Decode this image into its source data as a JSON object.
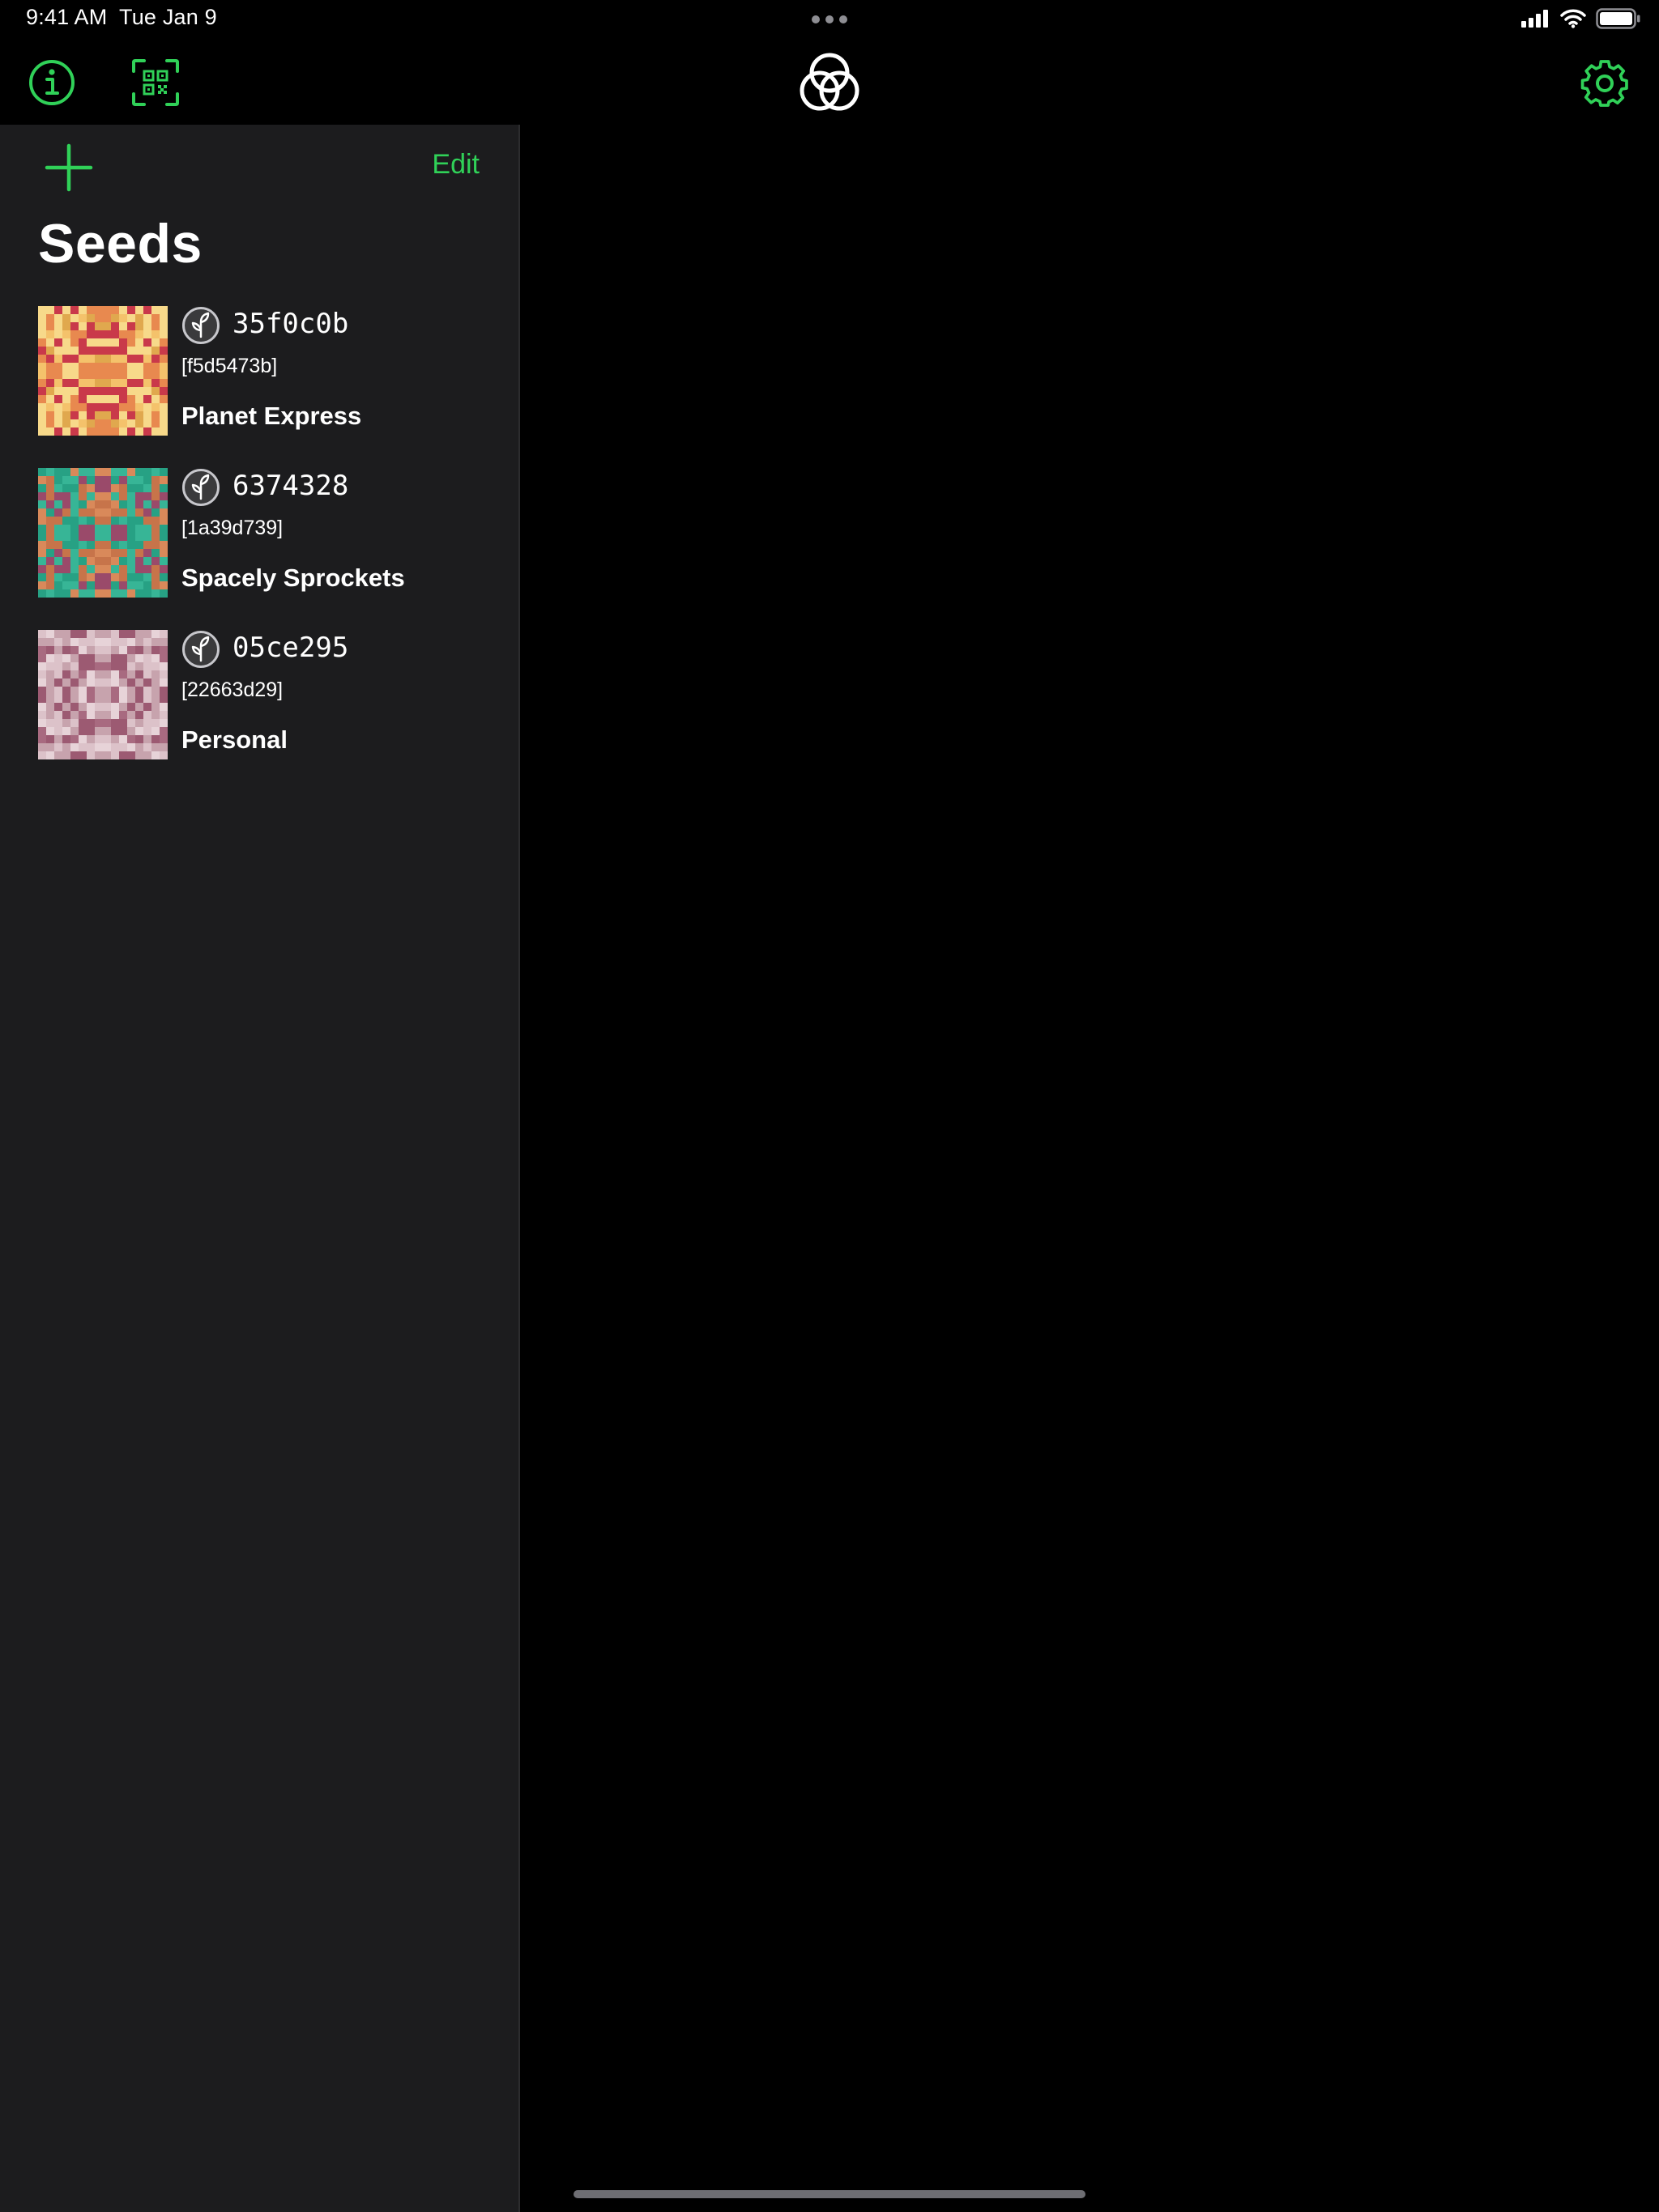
{
  "status_bar": {
    "time": "9:41 AM",
    "date": "Tue Jan 9"
  },
  "navigation": {
    "info_icon": "info-circle-icon",
    "scan_icon": "qr-code-scan-icon",
    "logo_icon": "gordian-seed-tool-logo-icon",
    "settings_icon": "gear-icon"
  },
  "sidebar": {
    "add_icon": "plus-icon",
    "edit_label": "Edit",
    "title": "Seeds",
    "seeds": [
      {
        "id": "35f0c0b",
        "fingerprint": "[f5d5473b]",
        "name": "Planet Express",
        "icon": "leaf-icon",
        "palette": [
          "#f4c26b",
          "#e8894f",
          "#c9394a",
          "#e0a84e",
          "#f7d98a"
        ]
      },
      {
        "id": "6374328",
        "fingerprint": "[1a39d739]",
        "name": "Spacely Sprockets",
        "icon": "leaf-icon",
        "palette": [
          "#27a184",
          "#37b596",
          "#c7744a",
          "#9a4a6a",
          "#d9895a"
        ]
      },
      {
        "id": "05ce295",
        "fingerprint": "[22663d29]",
        "name": "Personal",
        "icon": "leaf-icon",
        "palette": [
          "#c7a3ad",
          "#dcc2c9",
          "#a86a80",
          "#e7d3d8",
          "#9c5a72"
        ]
      }
    ]
  },
  "colors": {
    "accent": "#30d158",
    "background": "#000000",
    "sidebar_background": "#1c1c1e"
  }
}
